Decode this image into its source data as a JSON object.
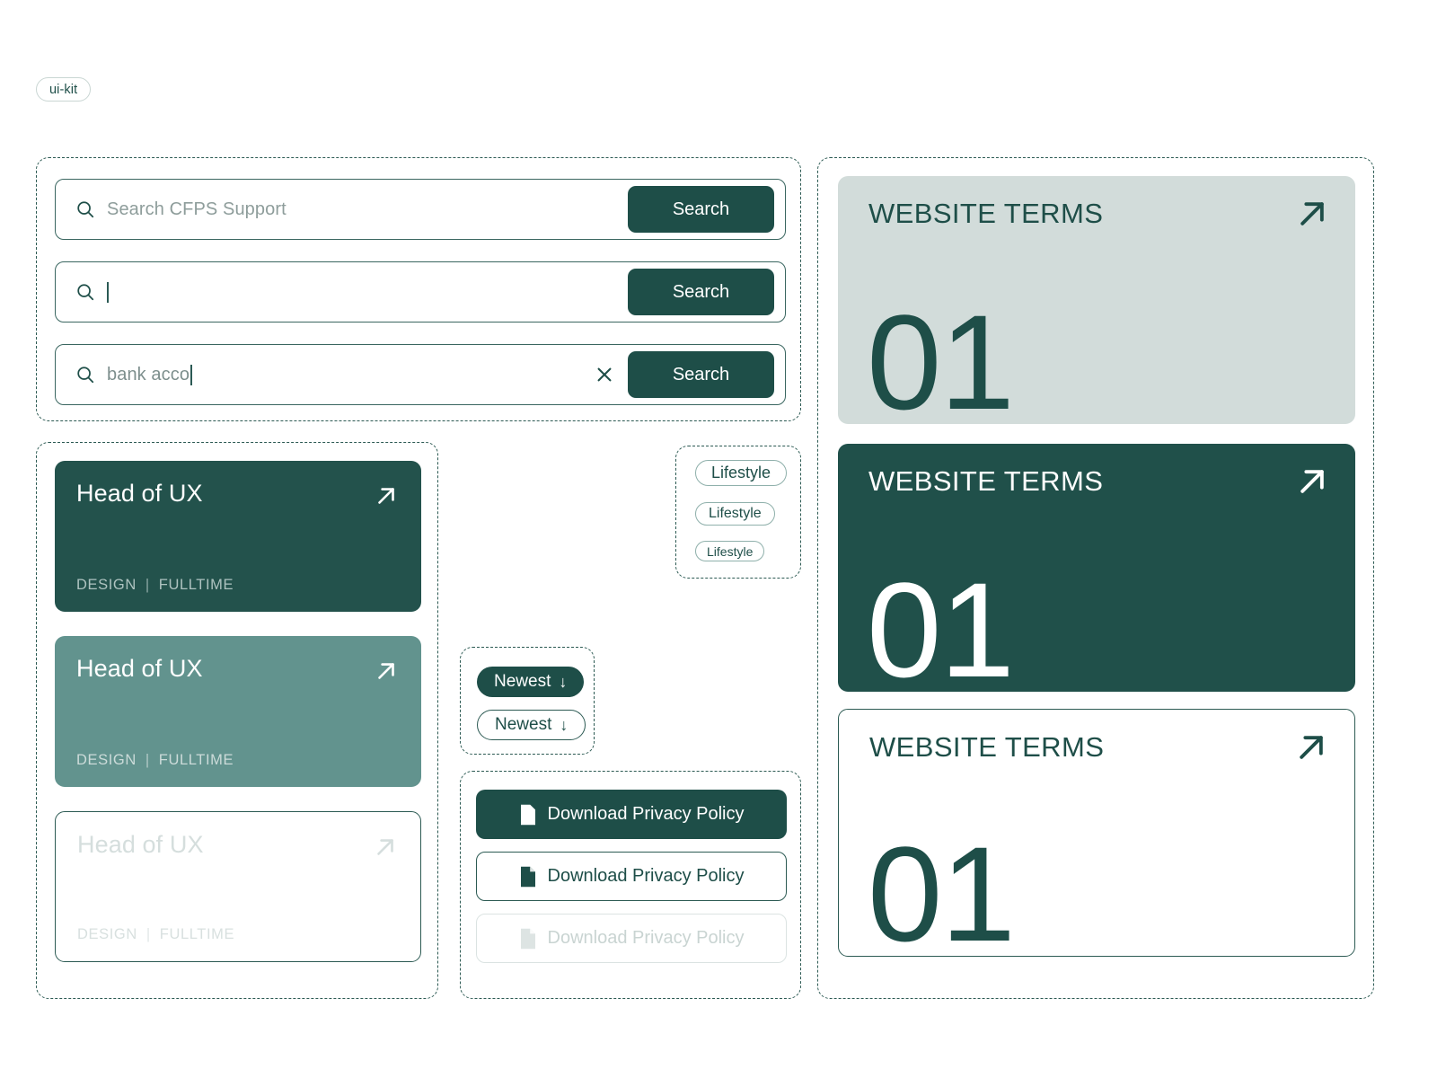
{
  "meta": {
    "kit_tag": "ui-kit"
  },
  "colors": {
    "dark_green": "#1E4E48",
    "card_dark": "#23524C",
    "card_medium": "#62938E",
    "card_light": "#D2DCDA",
    "border_green": "#2C5A53",
    "placeholder_grey": "#8E9D9B",
    "disabled_grey": "#D5DEDD",
    "white": "#FFFFFF"
  },
  "search_group": {
    "name": "search-bar-variants",
    "rows": [
      {
        "state": "placeholder",
        "icon": "search-icon",
        "placeholder": "Search CFPS Support",
        "value": "",
        "show_caret": false,
        "show_clear": false,
        "button_label": "Search"
      },
      {
        "state": "focused-empty",
        "icon": "search-icon",
        "placeholder": "",
        "value": "",
        "show_caret": true,
        "show_clear": false,
        "button_label": "Search"
      },
      {
        "state": "typed",
        "icon": "search-icon",
        "placeholder": "",
        "value": "bank acco",
        "show_caret": true,
        "show_clear": true,
        "clear_icon": "close-icon",
        "button_label": "Search"
      }
    ]
  },
  "job_cards": {
    "name": "job-card-variants",
    "cards": [
      {
        "variant": "default",
        "title": "Head of UX",
        "category": "DESIGN",
        "separator": "|",
        "employment": "FULLTIME",
        "arrow_icon": "arrow-up-right-icon",
        "background": "#23524C"
      },
      {
        "variant": "hover",
        "title": "Head of UX",
        "category": "DESIGN",
        "separator": "|",
        "employment": "FULLTIME",
        "arrow_icon": "arrow-up-right-icon",
        "background": "#62938E"
      },
      {
        "variant": "disabled",
        "title": "Head of UX",
        "category": "DESIGN",
        "separator": "|",
        "employment": "FULLTIME",
        "arrow_icon": "arrow-up-right-icon",
        "background": "#FFFFFF"
      }
    ]
  },
  "tags_group": {
    "name": "tag-pill-sizes",
    "pills": [
      {
        "label": "Lifestyle",
        "size": "large"
      },
      {
        "label": "Lifestyle",
        "size": "medium"
      },
      {
        "label": "Lifestyle",
        "size": "small"
      }
    ]
  },
  "sort_group": {
    "name": "sort-button-variants",
    "buttons": [
      {
        "label": "Newest",
        "arrow": "↓",
        "variant": "filled"
      },
      {
        "label": "Newest",
        "arrow": "↓",
        "variant": "outlined"
      }
    ]
  },
  "download_group": {
    "name": "download-button-variants",
    "buttons": [
      {
        "label": "Download Privacy Policy",
        "icon": "pdf-file-icon",
        "variant": "filled"
      },
      {
        "label": "Download Privacy Policy",
        "icon": "pdf-file-icon",
        "variant": "outlined"
      },
      {
        "label": "Download Privacy Policy",
        "icon": "pdf-file-icon",
        "variant": "disabled"
      }
    ]
  },
  "terms_group": {
    "name": "website-terms-card-variants",
    "cards": [
      {
        "title": "WEBSITE TERMS",
        "number": "01",
        "arrow_icon": "arrow-up-right-icon",
        "variant": "light",
        "background": "#D2DCDA"
      },
      {
        "title": "WEBSITE TERMS",
        "number": "01",
        "arrow_icon": "arrow-up-right-icon",
        "variant": "dark",
        "background": "#20504A"
      },
      {
        "title": "WEBSITE TERMS",
        "number": "01",
        "arrow_icon": "arrow-up-right-icon",
        "variant": "outline",
        "background": "#FFFFFF"
      }
    ]
  }
}
